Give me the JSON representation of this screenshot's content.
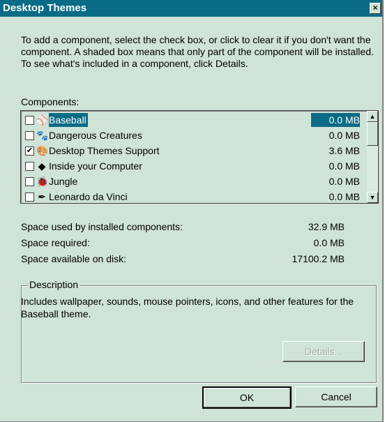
{
  "window": {
    "title": "Desktop Themes",
    "close_glyph": "×"
  },
  "intro": "To add a component, select the check box, or click to clear it if you don't want the component. A shaded box means that only part of the component will be installed. To see what's included in a component, click Details.",
  "components": {
    "label": "Components:",
    "items": [
      {
        "name": "Baseball",
        "size": "0.0 MB",
        "checked": false,
        "selected": true,
        "icon": "baseball-icon",
        "glyph": "⚾"
      },
      {
        "name": "Dangerous Creatures",
        "size": "0.0 MB",
        "checked": false,
        "selected": false,
        "icon": "creatures-icon",
        "glyph": "🐾"
      },
      {
        "name": "Desktop Themes Support",
        "size": "3.6 MB",
        "checked": true,
        "selected": false,
        "icon": "themes-support-icon",
        "glyph": "🎨"
      },
      {
        "name": "Inside your Computer",
        "size": "0.0 MB",
        "checked": false,
        "selected": false,
        "icon": "computer-icon",
        "glyph": "◆"
      },
      {
        "name": "Jungle",
        "size": "0.0 MB",
        "checked": false,
        "selected": false,
        "icon": "jungle-icon",
        "glyph": "🐞"
      },
      {
        "name": "Leonardo da Vinci",
        "size": "0.0 MB",
        "checked": false,
        "selected": false,
        "icon": "leonardo-icon",
        "glyph": "✒"
      }
    ]
  },
  "space": {
    "used_label": "Space used by installed components:",
    "used_value": "32.9 MB",
    "required_label": "Space required:",
    "required_value": "0.0 MB",
    "available_label": "Space available on disk:",
    "available_value": "17100.2 MB"
  },
  "description": {
    "title": "Description",
    "text": "Includes wallpaper, sounds, mouse pointers, icons, and other features for the Baseball theme."
  },
  "buttons": {
    "details": "Details...",
    "ok": "OK",
    "cancel": "Cancel"
  },
  "colors": {
    "titlebar": "#0a6b86",
    "face": "#cfe3d6",
    "selection": "#0a6b86"
  }
}
